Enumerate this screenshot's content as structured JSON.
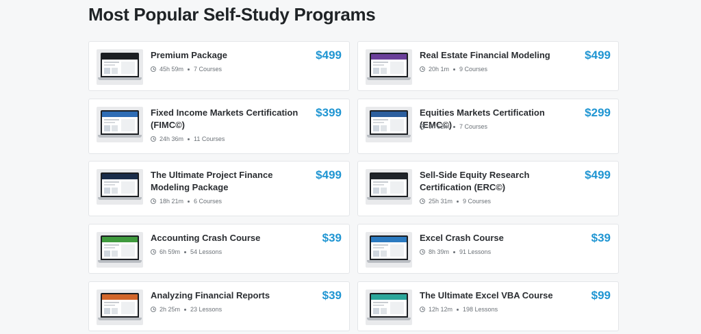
{
  "heading": "Most Popular Self-Study Programs",
  "programs": [
    {
      "title": "Premium Package",
      "price": "$499",
      "duration": "45h 59m",
      "count": "7 Courses",
      "thumb_color": "#1b1e22"
    },
    {
      "title": "Real Estate Financial Modeling",
      "price": "$499",
      "duration": "20h 1m",
      "count": "9 Courses",
      "thumb_color": "#6a3f9a"
    },
    {
      "title": "Fixed Income Markets Certification (FIMC©)",
      "price": "$399",
      "duration": "24h 36m",
      "count": "11 Courses",
      "thumb_color": "#2f6db5"
    },
    {
      "title": "Equities Markets Certification (EMC©)",
      "price": "$299",
      "duration": "9h 52m",
      "count": "7 Courses",
      "thumb_color": "#2d5f9e"
    },
    {
      "title": "The Ultimate Project Finance Modeling Package",
      "price": "$499",
      "duration": "18h 21m",
      "count": "6 Courses",
      "thumb_color": "#1a2d4a"
    },
    {
      "title": "Sell-Side Equity Research Certification (ERC©)",
      "price": "$499",
      "duration": "25h 31m",
      "count": "9 Courses",
      "thumb_color": "#20242a"
    },
    {
      "title": "Accounting Crash Course",
      "price": "$39",
      "duration": "6h 59m",
      "count": "54 Lessons",
      "thumb_color": "#3f9a3d"
    },
    {
      "title": "Excel Crash Course",
      "price": "$39",
      "duration": "8h 39m",
      "count": "91 Lessons",
      "thumb_color": "#2b7ac0"
    },
    {
      "title": "Analyzing Financial Reports",
      "price": "$39",
      "duration": "2h 25m",
      "count": "23 Lessons",
      "thumb_color": "#d2662a"
    },
    {
      "title": "The Ultimate Excel VBA Course",
      "price": "$99",
      "duration": "12h 12m",
      "count": "198 Lessons",
      "thumb_color": "#2aa69a"
    }
  ]
}
